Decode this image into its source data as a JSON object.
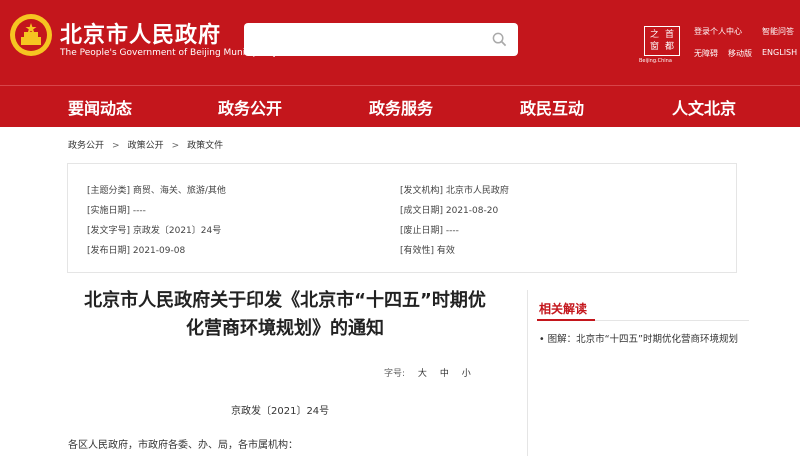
{
  "header": {
    "title": "北京市人民政府",
    "subtitle": "The People's Government of Beijing Municipality",
    "search_placeholder": "",
    "logo_chars": [
      "首",
      "之",
      "都",
      "窗"
    ],
    "logo_caption": "Beijing.China",
    "links": {
      "login": "登录个人中心",
      "accessible": "无障碍",
      "mobile": "移动版",
      "smart_qa": "智能问答",
      "english": "ENGLISH •"
    }
  },
  "nav": {
    "items": [
      "要闻动态",
      "政务公开",
      "政务服务",
      "政民互动",
      "人文北京"
    ]
  },
  "breadcrumb": {
    "items": [
      "政务公开",
      "政策公开",
      "政策文件"
    ],
    "separator": ">"
  },
  "meta": {
    "category": "[主题分类] 商贸、海关、旅游/其他",
    "effective_date": "[实施日期] ----",
    "doc_number": "[发文字号] 京政发〔2021〕24号",
    "publish_date": "[发布日期] 2021-09-08",
    "issuer": "[发文机构] 北京市人民政府",
    "written_date": "[成文日期] 2021-08-20",
    "repeal_date": "[废止日期] ----",
    "validity": "[有效性] 有效"
  },
  "article": {
    "title_line1": "北京市人民政府关于印发《北京市“十四五”时期优",
    "title_line2": "化营商环境规划》的通知",
    "fontsize_label": "字号:",
    "fontsize_options": [
      "大",
      "中",
      "小"
    ],
    "doc_no": "京政发〔2021〕24号",
    "salutation": "各区人民政府，市政府各委、办、局，各市属机构："
  },
  "side": {
    "title": "相关解读",
    "items": [
      "• 图解：北京市“十四五”时期优化营商环境规划"
    ]
  },
  "colors": {
    "brand_red": "#c4161c",
    "emblem_gold": "#f6c521"
  }
}
